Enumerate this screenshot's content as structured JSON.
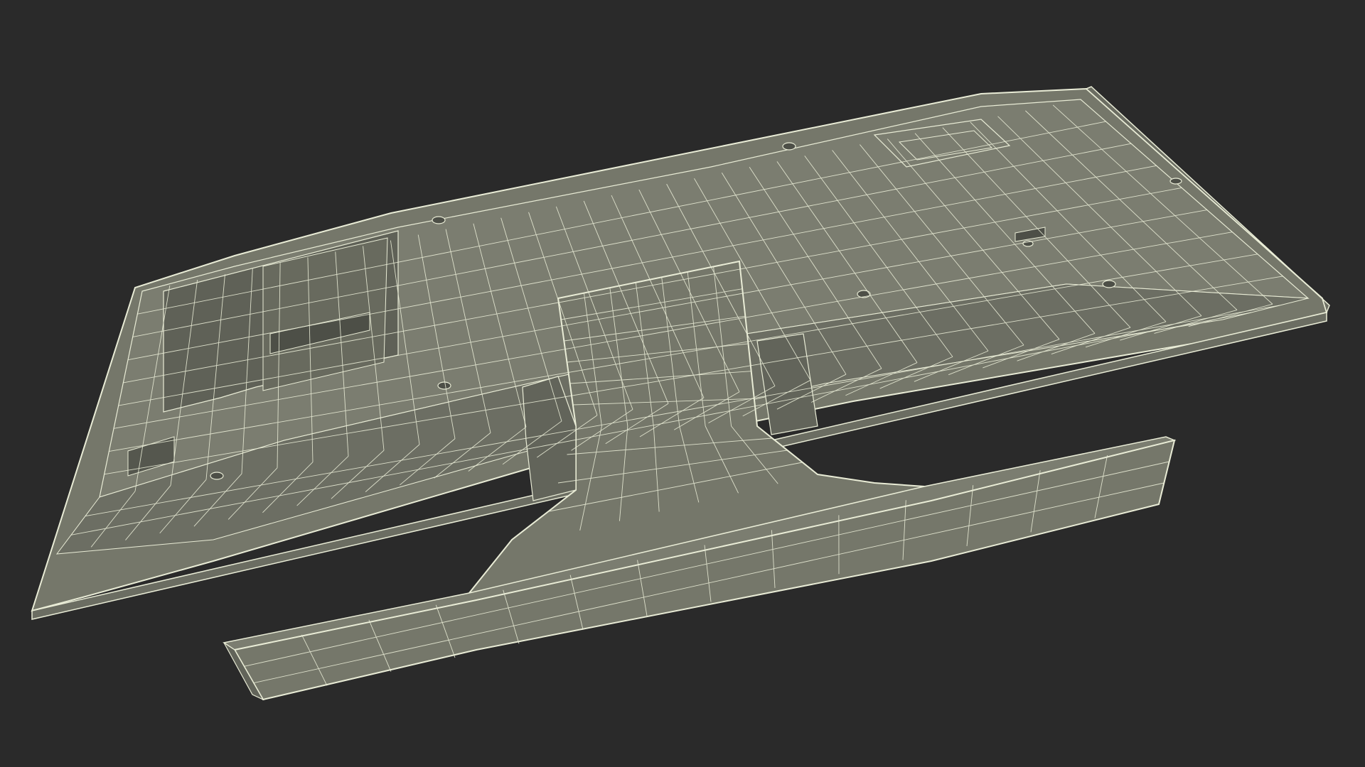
{
  "scene": {
    "subject": "monitor-wireframe-render",
    "colors": {
      "background": "#2a2a2a",
      "surface": "#75776a",
      "surface_dark": "#5f6157",
      "surface_light": "#858779",
      "wire": "#e9ecd6"
    }
  }
}
